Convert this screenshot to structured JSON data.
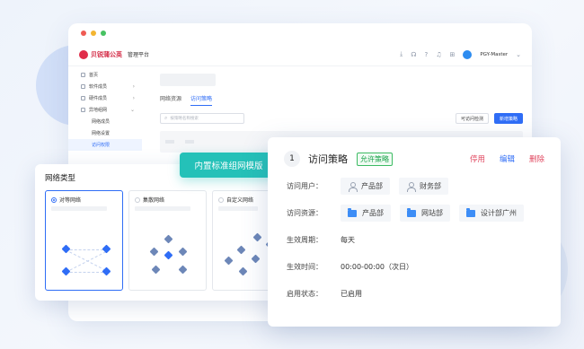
{
  "header": {
    "logo_text": "贝锐蒲公英",
    "platform_name": "管理平台",
    "user_name": "PGY-Master"
  },
  "sidebar": {
    "items": [
      {
        "label": "首页"
      },
      {
        "label": "软件成员"
      },
      {
        "label": "硬件成员"
      },
      {
        "label": "异地组网"
      },
      {
        "label": "网络成员"
      },
      {
        "label": "网络设置"
      },
      {
        "label": "访问权限"
      }
    ]
  },
  "main": {
    "tabs": [
      {
        "label": "网络资源"
      },
      {
        "label": "访问策略"
      }
    ],
    "search_placeholder": "按策略名称搜索",
    "check_button": "可访问检测",
    "new_button": "新增策略"
  },
  "network_type": {
    "title": "网络类型",
    "options": [
      {
        "label": "对等网络",
        "selected": true
      },
      {
        "label": "集散网络",
        "selected": false
      },
      {
        "label": "自定义网络",
        "selected": false
      }
    ]
  },
  "banner": {
    "text": "内置标准组网模版"
  },
  "policy": {
    "index": "1",
    "title": "访问策略",
    "badge": "允许策略",
    "actions": {
      "disable": "停用",
      "edit": "编辑",
      "delete": "删除"
    },
    "rows": {
      "users_label": "访问用户：",
      "users": [
        "产品部",
        "财务部"
      ],
      "resources_label": "访问资源：",
      "resources": [
        "产品部",
        "网站部",
        "设计部广州"
      ],
      "period_label": "生效周期：",
      "period_value": "每天",
      "time_label": "生效时间：",
      "time_value": "00:00-00:00（次日）",
      "status_label": "启用状态：",
      "status_value": "已启用"
    }
  },
  "colors": {
    "accent": "#2f6df6",
    "banner": "#24c1b8",
    "allow_green": "#1aa34a",
    "danger": "#e0475f"
  }
}
